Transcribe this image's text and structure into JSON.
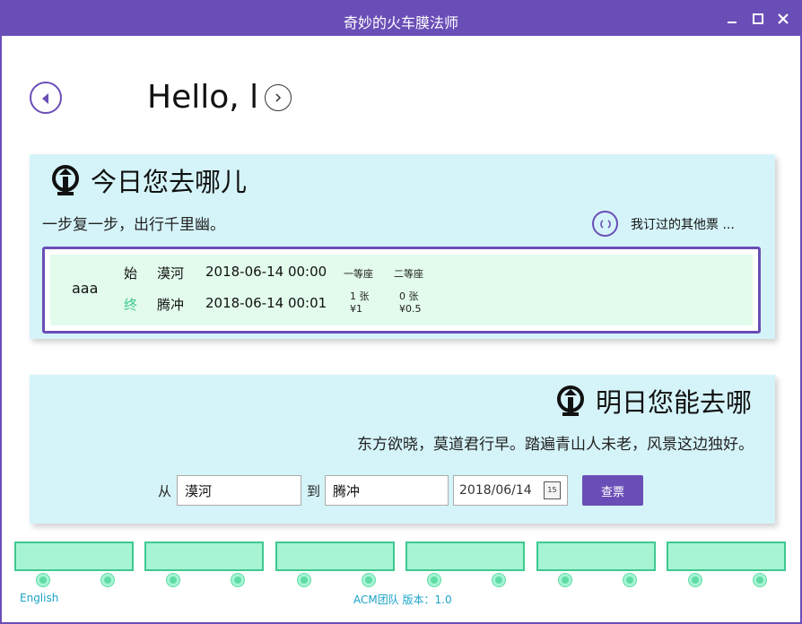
{
  "window": {
    "title": "奇妙的火车膜法师"
  },
  "header": {
    "greeting": "Hello, l"
  },
  "today": {
    "heading": "今日您去哪儿",
    "motto": "一步复一步，出行千里幽。",
    "other_tickets": "我订过的其他票 ...",
    "ticket": {
      "name": "aaa",
      "start_label": "始",
      "end_label": "终",
      "from_station": "漠河",
      "to_station": "腾冲",
      "depart_time": "2018-06-14 00:00",
      "arrive_time": "2018-06-14 00:01",
      "seat1_name": "一等座",
      "seat1_count": "1 张",
      "seat1_price": "¥1",
      "seat2_name": "二等座",
      "seat2_count": "0 张",
      "seat2_price": "¥0.5"
    }
  },
  "tomorrow": {
    "heading": "明日您能去哪",
    "motto": "东方欲晓，莫道君行早。踏遍青山人未老，风景这边独好。",
    "from_label": "从",
    "from_value": "漠河",
    "to_label": "到",
    "to_value": "腾冲",
    "date_value": "2018/06/14",
    "calendar_day": "15",
    "search_button": "查票"
  },
  "footer": {
    "language": "English",
    "version": "ACM团队 版本：1.0"
  },
  "colors": {
    "accent": "#6a4eb7",
    "card_bg": "#d5f4f9",
    "ticket_bg": "#e2fbec",
    "train": "#a6f4d4",
    "link": "#1aa3c9"
  }
}
